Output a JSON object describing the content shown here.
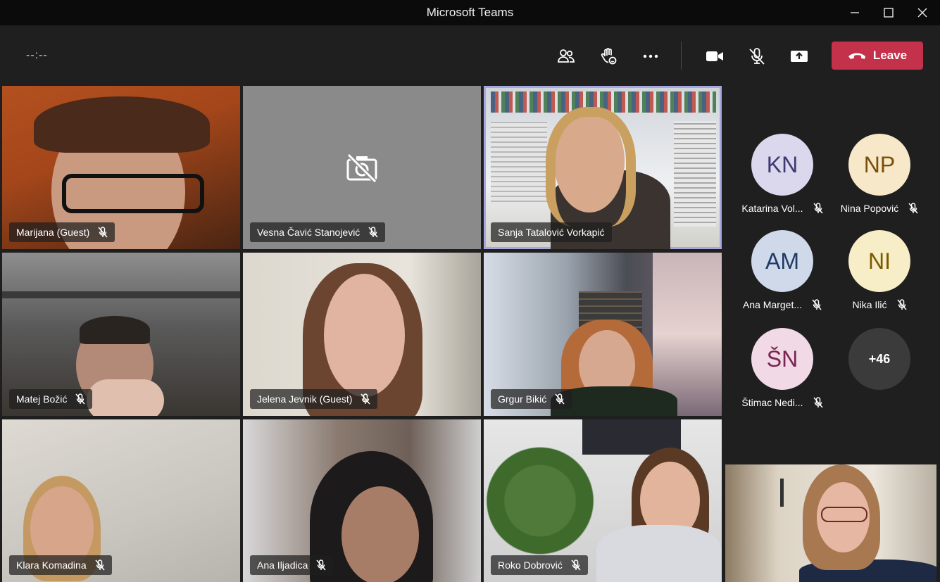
{
  "window": {
    "title": "Microsoft Teams"
  },
  "toolbar": {
    "timer": "--:--",
    "leave_label": "Leave"
  },
  "colors": {
    "leave": "#c4314b",
    "active_border": "#a6a7dc"
  },
  "participants": [
    {
      "name": "Marijana (Guest)"
    },
    {
      "name": "Vesna Čavić Stanojević"
    },
    {
      "name": "Sanja Tatalović Vorkapić"
    },
    {
      "name": "Matej Božić"
    },
    {
      "name": "Jelena Jevnik (Guest)"
    },
    {
      "name": "Grgur Bikić"
    },
    {
      "name": "Klara Komadina"
    },
    {
      "name": "Ana Iljadica"
    },
    {
      "name": "Roko Dobrović"
    }
  ],
  "roster": [
    {
      "initials": "KN",
      "name": "Katarina Vol...",
      "bg": "#dbd8ee",
      "fg": "#3d3a72"
    },
    {
      "initials": "NP",
      "name": "Nina Popović",
      "bg": "#f6e8c8",
      "fg": "#7a4f0a"
    },
    {
      "initials": "AM",
      "name": "Ana Marget...",
      "bg": "#cfd9ea",
      "fg": "#1f3b66"
    },
    {
      "initials": "NI",
      "name": "Nika Ilić",
      "bg": "#f7edc6",
      "fg": "#7a5a00"
    },
    {
      "initials": "ŠN",
      "name": "Štimac Nedi...",
      "bg": "#f1d9e6",
      "fg": "#7a2551"
    }
  ],
  "overflow": {
    "label": "+46"
  }
}
